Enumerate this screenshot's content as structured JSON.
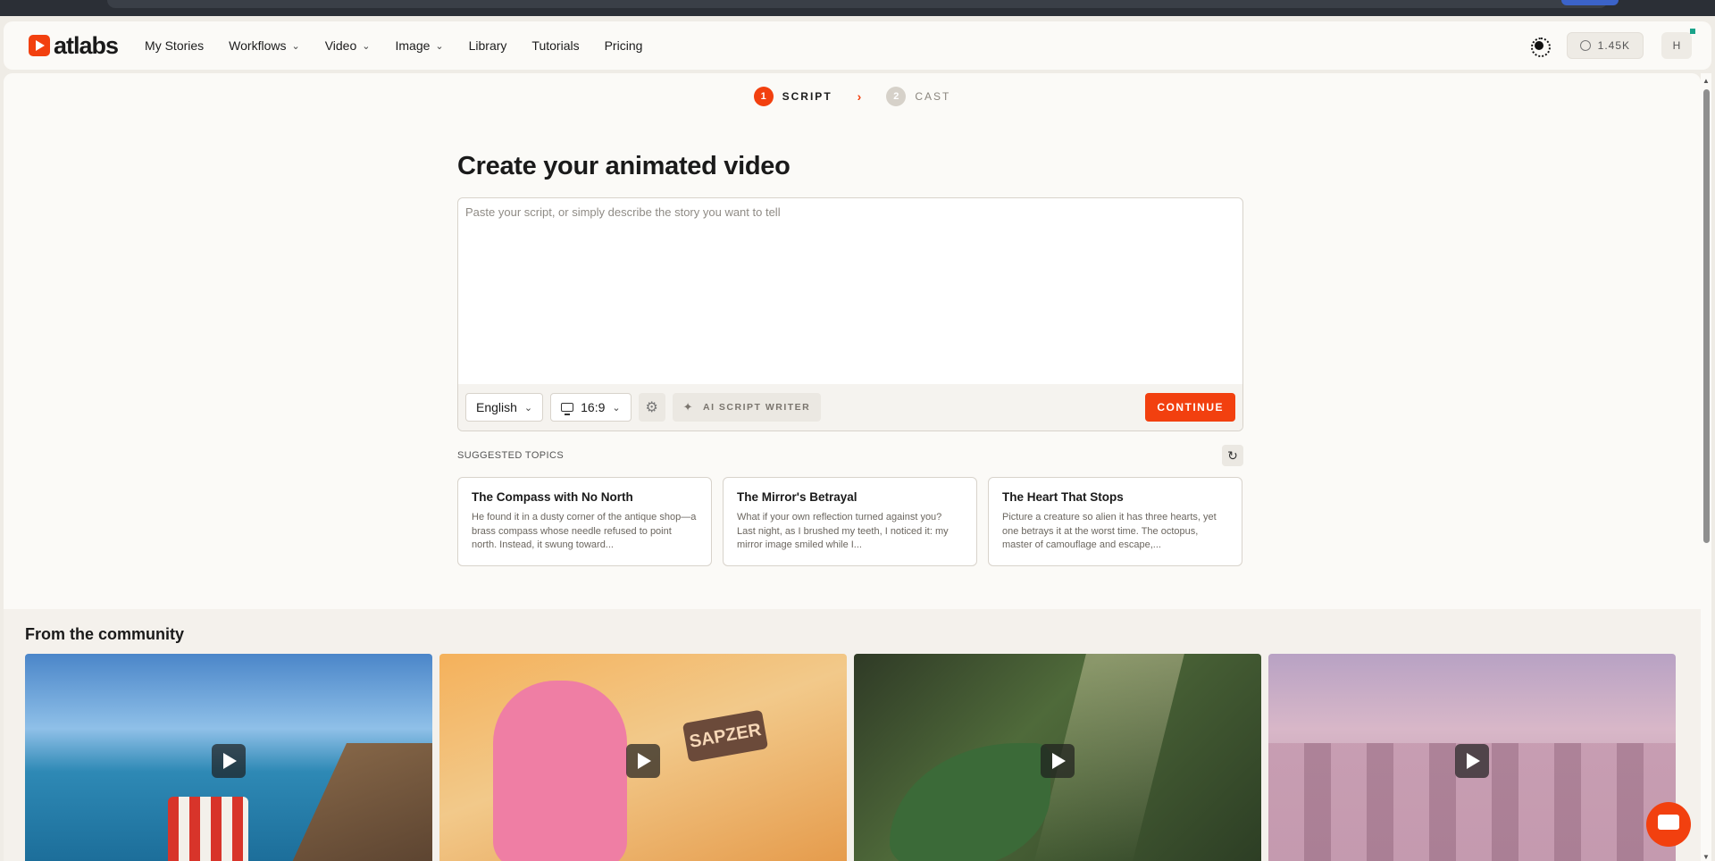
{
  "nav": {
    "brand": "atlabs",
    "links": [
      {
        "label": "My Stories",
        "dropdown": false
      },
      {
        "label": "Workflows",
        "dropdown": true
      },
      {
        "label": "Video",
        "dropdown": true
      },
      {
        "label": "Image",
        "dropdown": true
      },
      {
        "label": "Library",
        "dropdown": false
      },
      {
        "label": "Tutorials",
        "dropdown": false
      },
      {
        "label": "Pricing",
        "dropdown": false
      }
    ],
    "credits": "1.45K",
    "avatar_initial": "H"
  },
  "steps": [
    {
      "number": "1",
      "label": "SCRIPT",
      "active": true
    },
    {
      "number": "2",
      "label": "CAST",
      "active": false
    }
  ],
  "editor": {
    "title": "Create your animated video",
    "placeholder": "Paste your script, or simply describe the story you want to tell",
    "value": "",
    "language": "English",
    "aspect_ratio": "16:9",
    "ai_button": "AI SCRIPT WRITER",
    "continue_button": "CONTINUE"
  },
  "suggested": {
    "label": "SUGGESTED TOPICS",
    "topics": [
      {
        "title": "The Compass with No North",
        "desc": "He found it in a dusty corner of the antique shop—a brass compass whose needle refused to point north. Instead, it swung toward..."
      },
      {
        "title": "The Mirror's Betrayal",
        "desc": "What if your own reflection turned against you? Last night, as I brushed my teeth, I noticed it: my mirror image smiled while I..."
      },
      {
        "title": "The Heart That Stops",
        "desc": "Picture a creature so alien it has three hearts, yet one betrays it at the worst time. The octopus, master of camouflage and escape,..."
      }
    ]
  },
  "community": {
    "title": "From the community",
    "cards": [
      {
        "sign_text": ""
      },
      {
        "sign_text": "SAPZER"
      },
      {
        "sign_text": ""
      },
      {
        "sign_text": ""
      }
    ]
  },
  "colors": {
    "accent": "#f2400f",
    "page_bg": "#fbfaf7",
    "community_bg": "#f4f1ec"
  },
  "icons": {
    "theme_toggle": "sun-icon",
    "credits": "coin-icon",
    "settings": "gear-icon",
    "ai_writer": "wand-icon",
    "refresh": "refresh-icon",
    "play": "play-icon",
    "chat": "chat-icon"
  }
}
